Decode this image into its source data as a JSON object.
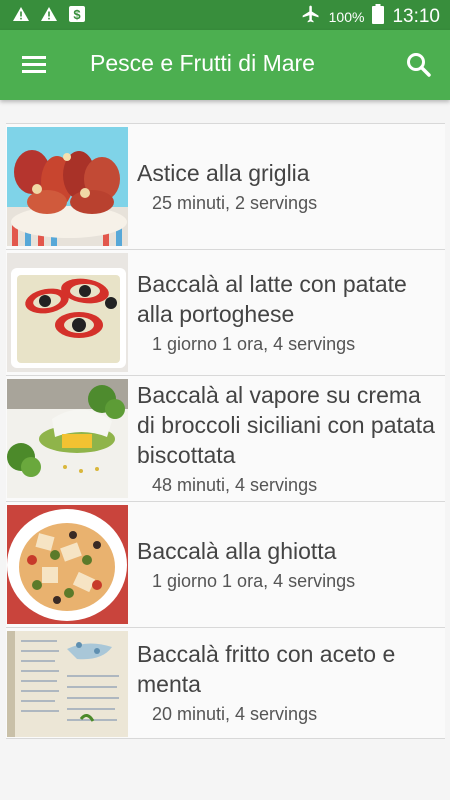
{
  "status_bar": {
    "battery_percent": "100%",
    "time": "13:10"
  },
  "app_bar": {
    "title": "Pesce e Frutti di Mare"
  },
  "recipes": [
    {
      "name": "Astice alla griglia",
      "meta": "25 minuti, 2 servings"
    },
    {
      "name": "Baccalà al latte con patate alla portoghese",
      "meta": "1 giorno 1 ora, 4 servings"
    },
    {
      "name": "Baccalà al vapore su crema di broccoli siciliani con patata biscottata",
      "meta": "48 minuti, 4 servings"
    },
    {
      "name": "Baccalà alla ghiotta",
      "meta": "1 giorno 1 ora, 4 servings"
    },
    {
      "name": "Baccalà fritto con aceto e menta",
      "meta": "20 minuti, 4 servings"
    }
  ],
  "colors": {
    "primary": "#4caf50",
    "primary_dark": "#388e3c"
  }
}
